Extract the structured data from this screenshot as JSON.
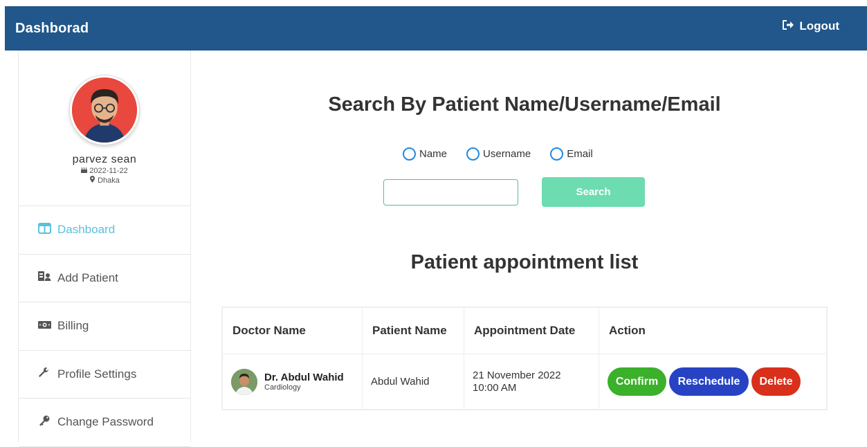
{
  "header": {
    "brand": "Dashborad",
    "logout_label": "Logout"
  },
  "profile": {
    "name": "parvez sean",
    "date": "2022-11-22",
    "location": "Dhaka"
  },
  "sidebar": {
    "items": [
      {
        "label": "Dashboard",
        "icon": "columns-icon",
        "active": true
      },
      {
        "label": "Add Patient",
        "icon": "id-card-user-icon",
        "active": false
      },
      {
        "label": "Billing",
        "icon": "money-bill-icon",
        "active": false
      },
      {
        "label": "Profile Settings",
        "icon": "wrench-icon",
        "active": false
      },
      {
        "label": "Change Password",
        "icon": "key-icon",
        "active": false
      }
    ]
  },
  "search": {
    "title": "Search By Patient Name/Username/Email",
    "options": [
      "Name",
      "Username",
      "Email"
    ],
    "input_value": "",
    "button_label": "Search"
  },
  "appointments": {
    "title": "Patient appointment list",
    "columns": [
      "Doctor Name",
      "Patient Name",
      "Appointment Date",
      "Action"
    ],
    "rows": [
      {
        "doctor_name": "Dr. Abdul Wahid",
        "doctor_specialty": "Cardiology",
        "patient_name": "Abdul Wahid",
        "date": "21 November 2022",
        "time": "10:00 AM",
        "actions": {
          "confirm": "Confirm",
          "reschedule": "Reschedule",
          "delete": "Delete"
        }
      }
    ]
  },
  "colors": {
    "header_bg": "#21578a",
    "active_nav": "#5bc0de",
    "search_button": "#6ddcb0",
    "confirm": "#3bb02a",
    "reschedule": "#2743c4",
    "delete": "#d9301c"
  }
}
